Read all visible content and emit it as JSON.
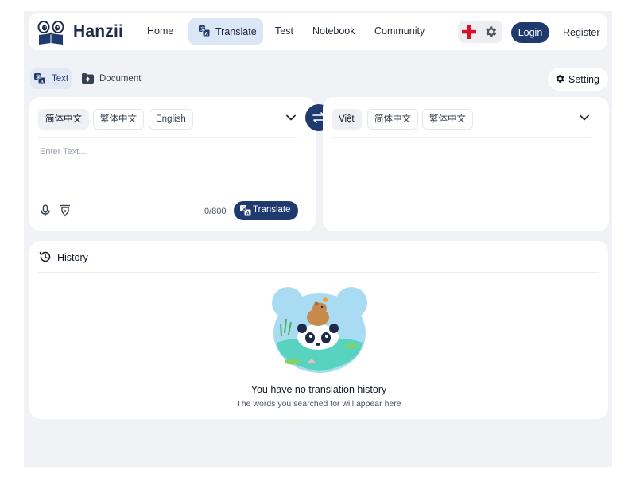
{
  "header": {
    "brand": "Hanzii",
    "nav": [
      {
        "label": "Home"
      },
      {
        "label": "Translate",
        "active": true
      },
      {
        "label": "Test"
      },
      {
        "label": "Notebook"
      },
      {
        "label": "Community"
      }
    ],
    "login_label": "Login",
    "register_label": "Register"
  },
  "modes": {
    "text_label": "Text",
    "document_label": "Document",
    "setting_label": "Setting"
  },
  "source": {
    "languages": [
      "简体中文",
      "繁体中文",
      "English"
    ],
    "selected": "简体中文",
    "input_value": "",
    "placeholder": "Enter Text...",
    "char_count": "0/800",
    "translate_label": "Translate"
  },
  "target": {
    "languages": [
      "Việt",
      "简体中文",
      "繁体中文"
    ],
    "selected": "Việt"
  },
  "history": {
    "title": "History",
    "empty_title": "You have no translation history",
    "empty_subtitle": "The words you searched for will appear here"
  },
  "icons": [
    "panda-logo-icon",
    "translate-icon",
    "uk-flag-icon",
    "gear-icon",
    "document-upload-icon",
    "swap-icon",
    "chevron-down-icon",
    "microphone-icon",
    "pen-icon",
    "history-icon"
  ],
  "colors": {
    "primary": "#1e3a6e",
    "active_tab_bg": "#dbe6f6",
    "page_bg": "#f1f2f6",
    "flag_red": "#d8102a"
  }
}
